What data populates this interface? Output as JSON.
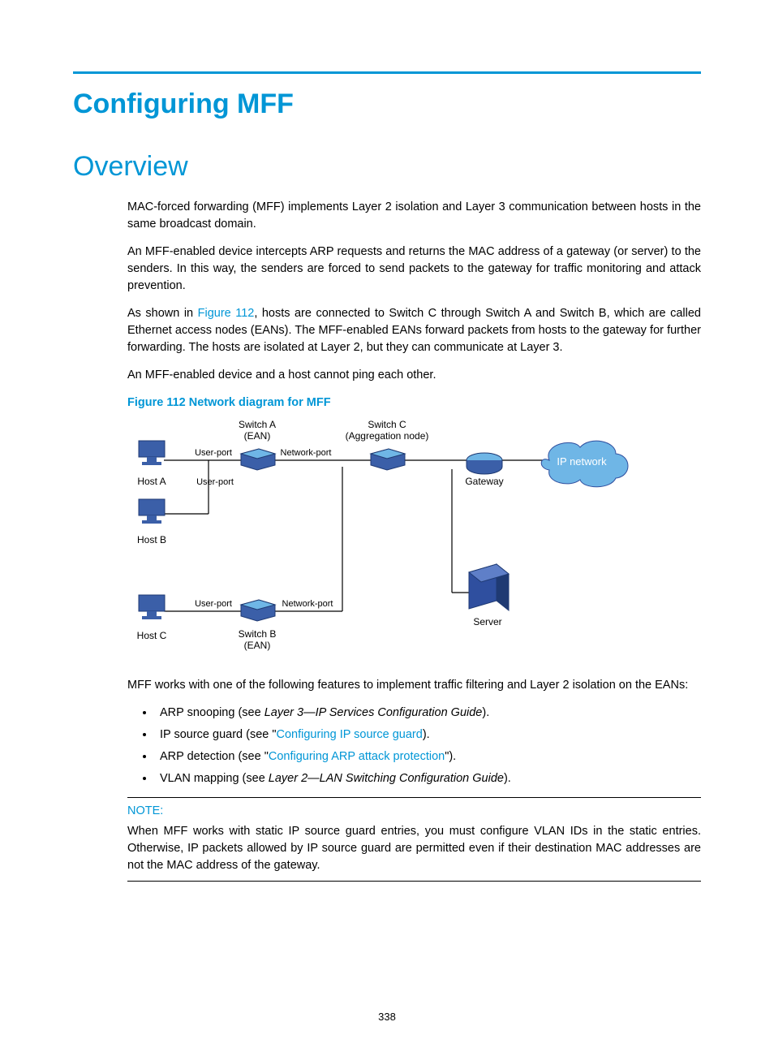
{
  "chapter_title": "Configuring MFF",
  "section_title": "Overview",
  "paragraphs": {
    "p1": "MAC-forced forwarding (MFF) implements Layer 2 isolation and Layer 3 communication between hosts in the same broadcast domain.",
    "p2": "An MFF-enabled device intercepts ARP requests and returns the MAC address of a gateway (or server) to the senders. In this way, the senders are forced to send packets to the gateway for traffic monitoring and attack prevention.",
    "p3a": "As shown in ",
    "p3link": "Figure 112",
    "p3b": ", hosts are connected to Switch C through Switch A and Switch B, which are called Ethernet access nodes (EANs). The MFF-enabled EANs forward packets from hosts to the gateway for further forwarding. The hosts are isolated at Layer 2, but they can communicate at Layer 3.",
    "p4": "An MFF-enabled device and a host cannot ping each other.",
    "p5": "MFF works with one of the following features to implement traffic filtering and Layer 2 isolation on the EANs:"
  },
  "figure_caption": "Figure 112 Network diagram for MFF",
  "diagram": {
    "hostA": "Host A",
    "hostB": "Host B",
    "hostC": "Host C",
    "switchA1": "Switch A",
    "switchA2": "(EAN)",
    "switchB1": "Switch B",
    "switchB2": "(EAN)",
    "switchC1": "Switch C",
    "switchC2": "(Aggregation node)",
    "userport": "User-port",
    "networkport": "Network-port",
    "gateway": "Gateway",
    "server": "Server",
    "ipnetwork": "IP network"
  },
  "bullets": {
    "b1a": "ARP snooping (see ",
    "b1i": "Layer 3—IP Services Configuration Guide",
    "b1b": ").",
    "b2a": "IP source guard (see \"",
    "b2link": "Configuring IP source guard",
    "b2b": ").",
    "b3a": "ARP detection (see \"",
    "b3link": "Configuring ARP attack protection",
    "b3b": "\").",
    "b4a": "VLAN mapping (see ",
    "b4i": "Layer 2—LAN Switching Configuration Guide",
    "b4b": ")."
  },
  "note": {
    "label": "NOTE:",
    "text": "When MFF works with static IP source guard entries, you must configure VLAN IDs in the static entries. Otherwise, IP packets allowed by IP source guard are permitted even if their destination MAC addresses are not the MAC address of the gateway."
  },
  "page_number": "338"
}
